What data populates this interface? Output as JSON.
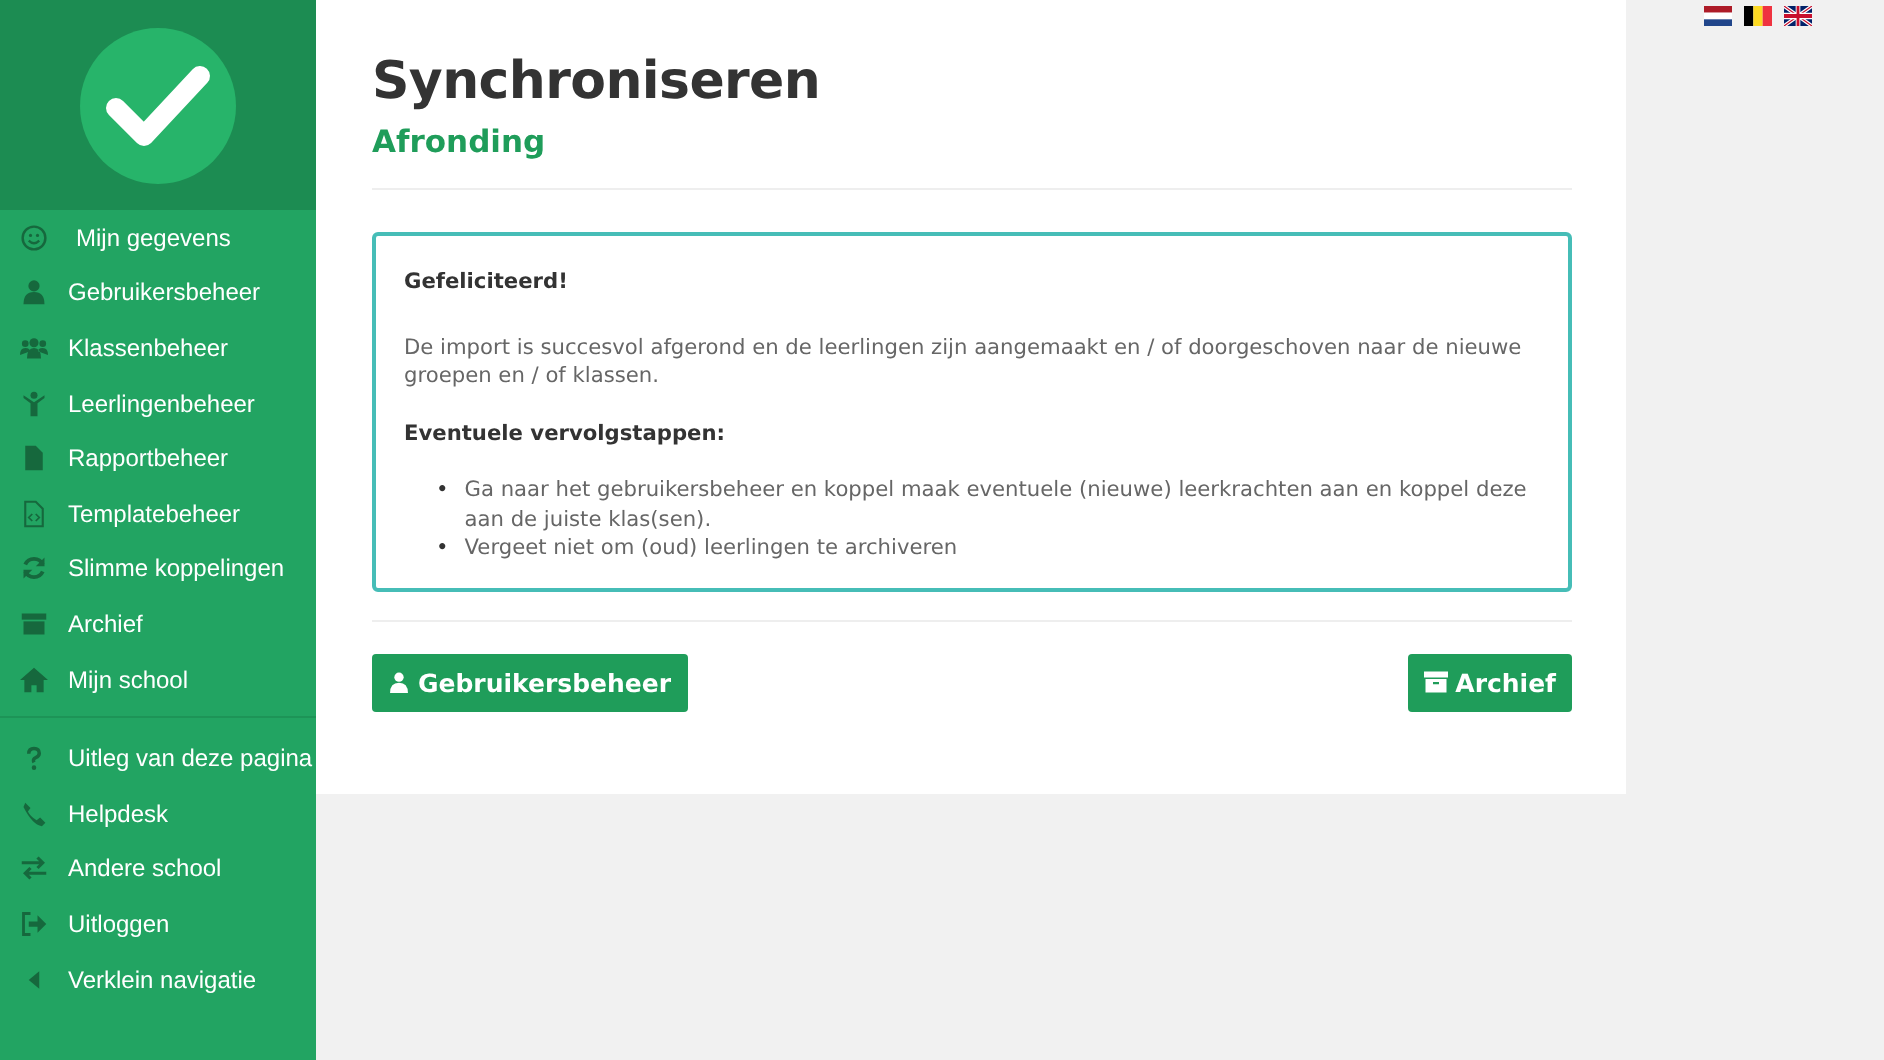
{
  "sidebar": {
    "items": [
      {
        "label": "Mijn gegevens"
      },
      {
        "label": "Gebruikersbeheer"
      },
      {
        "label": "Klassenbeheer"
      },
      {
        "label": "Leerlingenbeheer"
      },
      {
        "label": "Rapportbeheer"
      },
      {
        "label": "Templatebeheer"
      },
      {
        "label": "Slimme koppelingen"
      },
      {
        "label": "Archief"
      },
      {
        "label": "Mijn school"
      }
    ],
    "bottom_items": [
      {
        "label": "Uitleg van deze pagina"
      },
      {
        "label": "Helpdesk"
      },
      {
        "label": "Andere school"
      },
      {
        "label": "Uitloggen"
      },
      {
        "label": "Verklein navigatie"
      }
    ]
  },
  "page": {
    "title": "Synchroniseren",
    "subtitle": "Afronding"
  },
  "message": {
    "heading": "Gefeliciteerd!",
    "text": "De import is succesvol afgerond en de leerlingen zijn aangemaakt en / of doorgeschoven naar de nieuwe groepen en / of klassen.",
    "steps_heading": "Eventuele vervolgstappen:",
    "steps": [
      {
        "bullet": "•",
        "text": "Ga naar het gebruikersbeheer en koppel maak eventuele (nieuwe) leerkrachten aan en koppel deze aan de juiste klas(sen)."
      },
      {
        "bullet": "•",
        "text": "Vergeet niet om (oud) leerlingen te archiveren"
      }
    ]
  },
  "buttons": [
    {
      "label": "Gebruikersbeheer"
    },
    {
      "label": "Archief"
    }
  ]
}
